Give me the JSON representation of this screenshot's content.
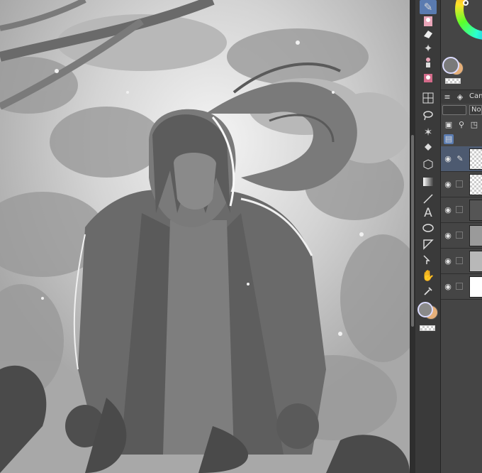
{
  "canvas": {
    "description_icon": "illustration-canvas"
  },
  "toolbar": {
    "tools": [
      {
        "icon": "pen-icon",
        "active": true
      },
      {
        "icon": "character-thumbnail-icon"
      },
      {
        "icon": "eraser-icon"
      },
      {
        "icon": "sparkle-icon"
      },
      {
        "icon": "figure-icon"
      },
      {
        "icon": "3d-figure-icon"
      },
      {
        "icon": "grid-icon"
      },
      {
        "icon": "lasso-icon"
      },
      {
        "icon": "magic-wand-icon"
      },
      {
        "icon": "fill-bucket-icon"
      },
      {
        "icon": "cube-icon"
      },
      {
        "icon": "gradient-icon"
      },
      {
        "icon": "line-icon"
      },
      {
        "icon": "text-icon",
        "glyph": "A"
      },
      {
        "icon": "balloon-icon"
      },
      {
        "icon": "ruler-icon"
      },
      {
        "icon": "move-icon"
      },
      {
        "icon": "hand-icon"
      },
      {
        "icon": "eyedropper-icon"
      }
    ],
    "main_color": "#8a8a8a",
    "sub_color": "#e6b07a"
  },
  "right_panel": {
    "layer_tab_label": "Can",
    "blend_mode_value": "No",
    "layers": [
      {
        "thumb": "checker",
        "selected": true,
        "has_pen": true
      },
      {
        "thumb": "checker"
      },
      {
        "thumb": "dark-sketch"
      },
      {
        "thumb": "gray-sketch"
      },
      {
        "thumb": "gray-fill"
      },
      {
        "thumb": "white"
      }
    ],
    "accent": "#5a7bb0"
  }
}
